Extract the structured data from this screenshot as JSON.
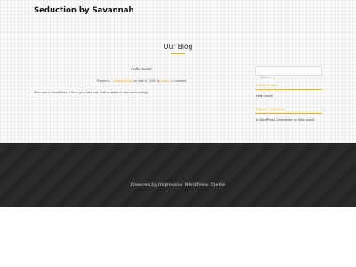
{
  "header": {
    "site_title": "Seduction by Savannah"
  },
  "page": {
    "title": "Our Blog"
  },
  "post": {
    "title": "Hello world!",
    "meta": {
      "posted_in_label": "Posted in :",
      "category": "Uncategorized",
      "on_label": "on",
      "date": "June 5, 2020",
      "by_label": "by",
      "author": "admin",
      "comments": "1 Comment"
    },
    "excerpt": "Welcome to WordPress. This is your first post. Edit or delete it, then start writing!"
  },
  "sidebar": {
    "search": {
      "placeholder": "Search ..."
    },
    "recent_posts": {
      "title": "Recent Posts",
      "items": [
        "Hello world!"
      ]
    },
    "recent_comments": {
      "title": "Recent Comments",
      "items": [
        {
          "author": "A WordPress Commenter",
          "on_label": "on",
          "post": "Hello world!"
        }
      ]
    }
  },
  "footer": {
    "credit": "Powered by Impressive WordPress Theme"
  },
  "colors": {
    "accent": "#e8b416",
    "footer_bg": "#262626",
    "background": "#fafafa"
  }
}
